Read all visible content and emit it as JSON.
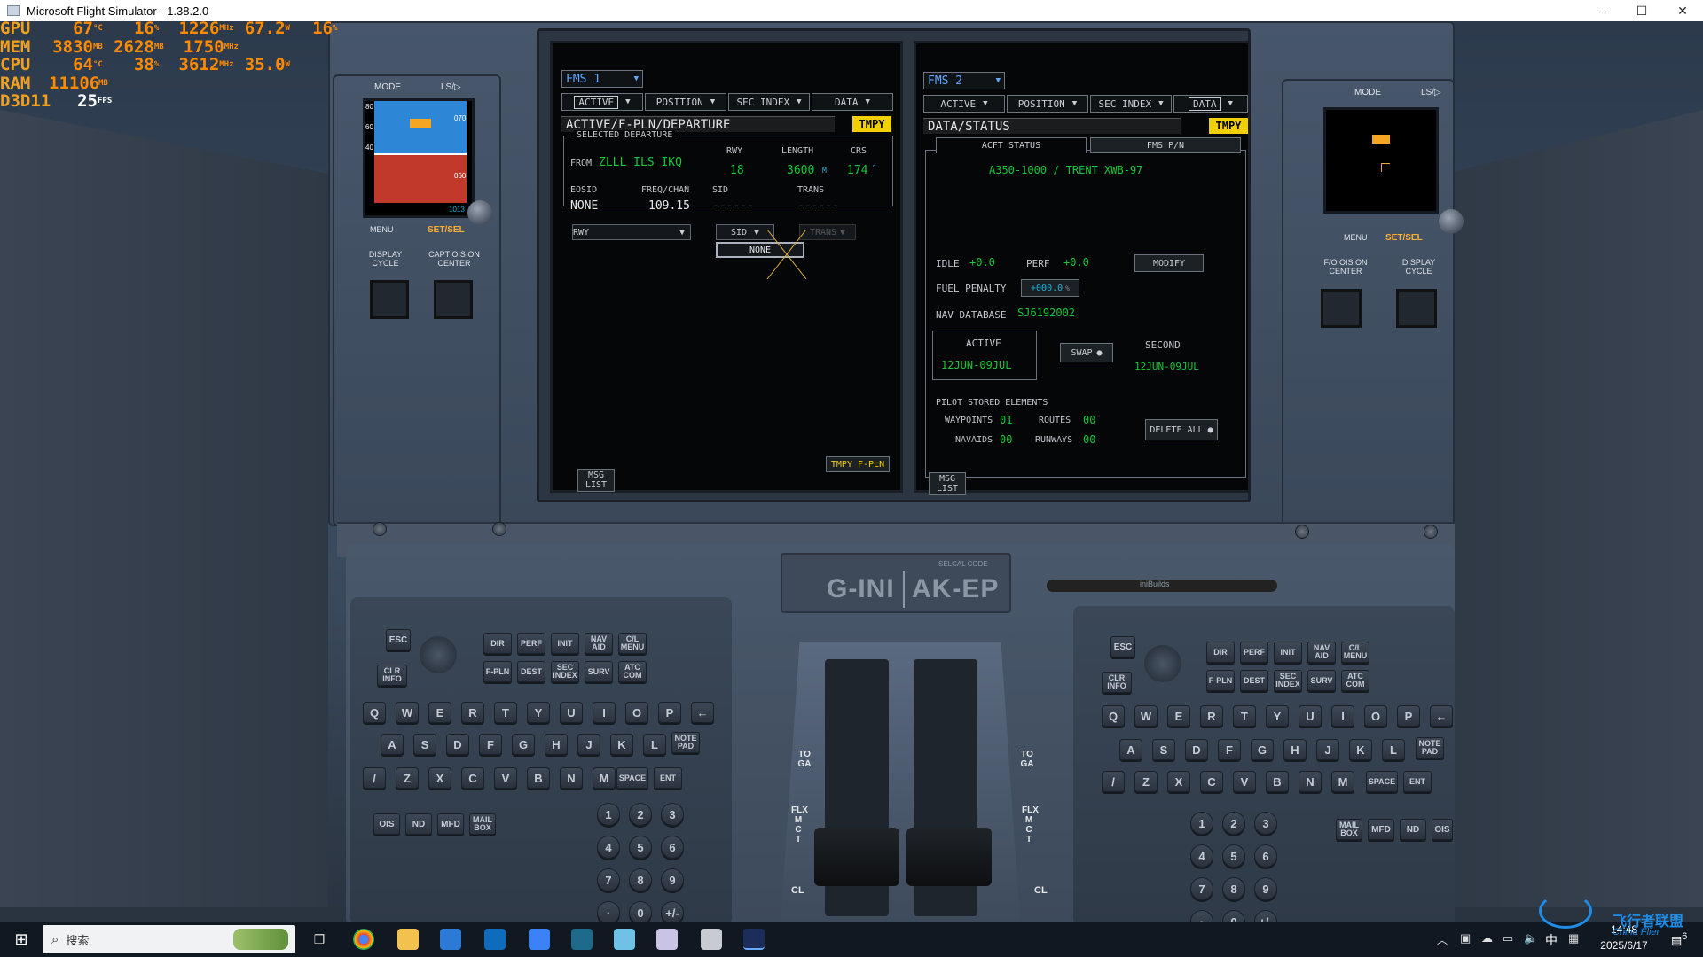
{
  "window": {
    "title": "Microsoft Flight Simulator - 1.38.2.0",
    "minimize": "–",
    "maximize": "☐",
    "close": "✕"
  },
  "perf": {
    "gpu": {
      "label": "GPU",
      "temp": "67",
      "temp_u": "°C",
      "load": "16",
      "load_u": "%",
      "clock": "1226",
      "clock_u": "MHz",
      "power": "67.2",
      "power_u": "W",
      "extra": "16",
      "extra_u": "%"
    },
    "mem": {
      "label": "MEM",
      "v1": "3830",
      "v1_u": "MB",
      "v2": "2628",
      "v2_u": "MB",
      "v3": "1750",
      "v3_u": "MHz"
    },
    "cpu": {
      "label": "CPU",
      "temp": "64",
      "temp_u": "°C",
      "load": "38",
      "load_u": "%",
      "clock": "3612",
      "clock_u": "MHz",
      "power": "35.0",
      "power_u": "W"
    },
    "ram": {
      "label": "RAM",
      "v1": "11106",
      "v1_u": "MB"
    },
    "d3d": {
      "label": "D3D11",
      "fps": "25",
      "fps_u": "FPS"
    }
  },
  "pfd_left": {
    "mode": "MODE",
    "ls": "LS/▷",
    "menu": "MENU",
    "setsel": "SET/SEL",
    "display_cycle": "DISPLAY CYCLE",
    "capt_ois": "CAPT OIS ON CENTER",
    "speed_tape": [
      "80",
      "60",
      "40"
    ],
    "alt_tape": [
      "070",
      "060"
    ],
    "baro": "1013"
  },
  "pfd_right": {
    "mode": "MODE",
    "ls": "LS/▷",
    "menu": "MENU",
    "setsel": "SET/SEL",
    "fo_ois": "F/O OIS ON CENTER",
    "display_cycle": "DISPLAY CYCLE"
  },
  "fms1": {
    "title": "FMS 1",
    "tabs": [
      "ACTIVE",
      "POSITION",
      "SEC INDEX",
      "DATA"
    ],
    "header": "ACTIVE/F-PLN/DEPARTURE",
    "tmpy": "TMPY",
    "selected_departure": "SELECTED DEPARTURE",
    "from_label": "FROM",
    "from_value": "ZLLL ILS IKQ",
    "rwy_label": "RWY",
    "rwy_value": "18",
    "length_label": "LENGTH",
    "length_value": "3600",
    "length_unit": "M",
    "crs_label": "CRS",
    "crs_value": "174",
    "crs_unit": "°",
    "eosid_label": "EOSID",
    "eosid_value": "NONE",
    "freq_label": "FREQ/CHAN",
    "freq_value": "109.15",
    "sid_label": "SID",
    "sid_value": "------",
    "trans_label": "TRANS",
    "trans_value": "------",
    "dd_rwy": "RWY",
    "dd_sid": "SID",
    "dd_trans": "TRANS",
    "sid_option": "NONE",
    "tmpy_fpln": "TMPY F-PLN",
    "msg_list": "MSG LIST"
  },
  "fms2": {
    "title": "FMS 2",
    "tabs": [
      "ACTIVE",
      "POSITION",
      "SEC INDEX",
      "DATA"
    ],
    "header": "DATA/STATUS",
    "tmpy": "TMPY",
    "tab_acft": "ACFT STATUS",
    "tab_fmspn": "FMS P/N",
    "acft_type": "A350-1000 / TRENT XWB-97",
    "idle_label": "IDLE",
    "idle_value": "+0.0",
    "perf_label": "PERF",
    "perf_value": "+0.0",
    "modify": "MODIFY",
    "fuel_penalty_label": "FUEL PENALTY",
    "fuel_penalty_value": "+000.0",
    "fuel_penalty_unit": "%",
    "nav_db_label": "NAV DATABASE",
    "nav_db_value": "SJ6192002",
    "active_label": "ACTIVE",
    "active_value": "12JUN-09JUL",
    "swap": "SWAP",
    "second_label": "SECOND",
    "second_value": "12JUN-09JUL",
    "pilot_stored": "PILOT STORED ELEMENTS",
    "waypoints_label": "WAYPOINTS",
    "waypoints_value": "01",
    "routes_label": "ROUTES",
    "routes_value": "00",
    "navaids_label": "NAVAIDS",
    "navaids_value": "00",
    "runways_label": "RUNWAYS",
    "runways_value": "00",
    "delete_all": "DELETE ALL",
    "msg_list": "MSG LIST"
  },
  "pedestal": {
    "registration_left": "G-INI",
    "registration_right": "AK-EP",
    "selcal": "SELCAL CODE",
    "brand": "iniBuilds",
    "toga_left": "TO GA",
    "toga_right": "TO GA",
    "flx_left": "FLX M C T",
    "flx_right": "FLX M C T",
    "cl_left": "CL",
    "cl_right": "CL"
  },
  "keyboard": {
    "fkeys_row1": [
      "DIR",
      "PERF",
      "INIT",
      "NAV AID",
      "C/L MENU"
    ],
    "fkeys_row2": [
      "F-PLN",
      "DEST",
      "SEC INDEX",
      "SURV",
      "ATC COM"
    ],
    "esc": "ESC",
    "clr_info": "CLR INFO",
    "row_q": [
      "Q",
      "W",
      "E",
      "R",
      "T",
      "Y",
      "U",
      "I",
      "O",
      "P",
      "←"
    ],
    "row_a": [
      "A",
      "S",
      "D",
      "F",
      "G",
      "H",
      "J",
      "K",
      "L"
    ],
    "note_pad": "NOTE PAD",
    "row_z": [
      "/",
      "Z",
      "X",
      "C",
      "V",
      "B",
      "N",
      "M"
    ],
    "space": "SPACE",
    "ent": "ENT",
    "bottom_left": [
      "OIS",
      "ND",
      "MFD",
      "MAIL BOX"
    ],
    "bottom_right": [
      "MAIL BOX",
      "MFD",
      "ND",
      "OIS"
    ],
    "digits": [
      "1",
      "2",
      "3",
      "4",
      "5",
      "6",
      "7",
      "8",
      "9",
      "·",
      "0",
      "+/-"
    ]
  },
  "taskbar": {
    "search": "搜索",
    "ime": "中",
    "time": "14:48",
    "date": "2025/6/17",
    "notif": "6",
    "watermark": "飞行者联盟",
    "watermark_en": "China Flier"
  }
}
